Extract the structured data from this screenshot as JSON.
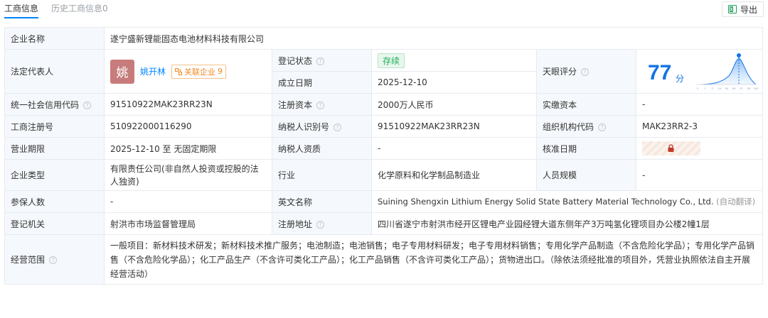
{
  "tabs": {
    "active": "工商信息",
    "inactive": "历史工商信息0"
  },
  "export": {
    "label": "导出"
  },
  "company": {
    "name_label": "企业名称",
    "name_value": "遂宁盛新锂能固态电池材料科技有限公司"
  },
  "legal_rep": {
    "label": "法定代表人",
    "avatar_char": "姚",
    "name": "姚开林",
    "related_label": "关联企业",
    "related_count": "9"
  },
  "reg_status": {
    "label": "登记状态",
    "value": "存续"
  },
  "found_date": {
    "label": "成立日期",
    "value": "2025-12-10"
  },
  "score": {
    "label": "天眼评分",
    "value": "77",
    "unit": "分",
    "ticks": [
      "0",
      "1",
      "3",
      "15",
      "50",
      "85",
      "97",
      "99",
      "100"
    ]
  },
  "rows": [
    {
      "l1": "统一社会信用代码",
      "v1": "91510922MAK23RR23N",
      "l2": "注册资本",
      "v2": "2000万人民币",
      "l3": "实缴资本",
      "v3": "-"
    },
    {
      "l1": "工商注册号",
      "v1": "510922000116290",
      "l2": "纳税人识别号",
      "v2": "91510922MAK23RR23N",
      "l3": "组织机构代码",
      "v3": "MAK23RR2-3"
    },
    {
      "l1": "营业期限",
      "v1": "2025-12-10 至 无固定期限",
      "l2": "纳税人资质",
      "v2": "-",
      "l3": "核准日期"
    },
    {
      "l1": "企业类型",
      "v1": "有限责任公司(非自然人投资或控股的法人独资)",
      "l2": "行业",
      "v2": "化学原料和化学制品制造业",
      "l3": "人员规模",
      "v3": "-"
    }
  ],
  "insured": {
    "label": "参保人数",
    "value": "-"
  },
  "english_name": {
    "label": "英文名称",
    "value": "Suining Shengxin Lithium Energy Solid State Battery Material Technology Co., Ltd.",
    "note": "(自动翻译)"
  },
  "authority": {
    "label": "登记机关",
    "value": "射洪市市场监督管理局"
  },
  "address": {
    "label": "注册地址",
    "value": "四川省遂宁市射洪市经开区锂电产业园经锂大道东侧年产3万吨氢化锂项目办公楼2幢1层"
  },
  "scope": {
    "label": "经营范围",
    "value": "一般项目：新材料技术研发；新材料技术推广服务；电池制造；电池销售；电子专用材料研发；电子专用材料销售；专用化学产品制造（不含危险化学品）；专用化学产品销售（不含危险化学品）；化工产品生产（不含许可类化工产品）；化工产品销售（不含许可类化工产品）；货物进出口。（除依法须经批准的项目外，凭营业执照依法自主开展经营活动）"
  },
  "colors": {
    "accent": "#0084ff",
    "score_blue": "#1474e6",
    "status_green": "#1fae5b",
    "label_bg": "#f5f8fc",
    "border": "#e6ebf1"
  }
}
